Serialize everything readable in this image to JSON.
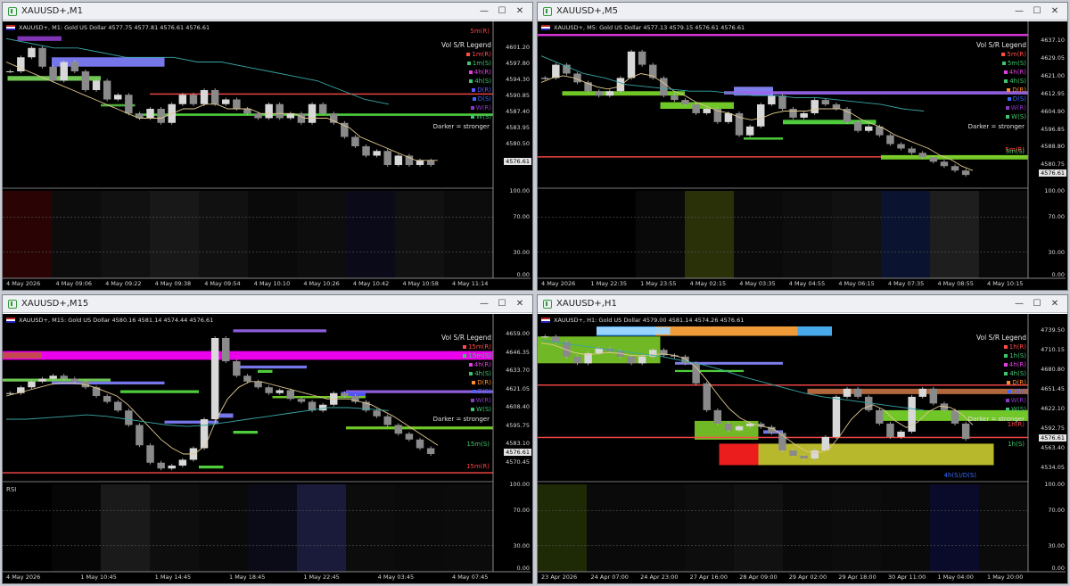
{
  "panels": [
    {
      "window_title": "XAUUSD+,M1",
      "symbol_info": "XAUUSD+, M1:  Gold US Dollar  4577.75 4577.81 4576.61 4576.61",
      "legend_title": "Vol S/R Legend",
      "legend_items": [
        {
          "text": "1m(R)",
          "color": "#ff4a4a"
        },
        {
          "text": "1m(S)",
          "color": "#3ec46d"
        },
        {
          "text": "4h(R)",
          "color": "#e040e0"
        },
        {
          "text": "4h(S)",
          "color": "#3ec46d"
        },
        {
          "text": "D(R)",
          "color": "#5a5aff"
        },
        {
          "text": "D(S)",
          "color": "#3a6aff"
        },
        {
          "text": "W(R)",
          "color": "#8a3ac4"
        },
        {
          "text": "W(S)",
          "color": "#3ec46d"
        }
      ],
      "zone_labels": [
        {
          "text": "5m(R)",
          "color": "#ff4040"
        },
        {
          "text": "Darker = stronger",
          "color": "#e0e0e0"
        }
      ],
      "price_axis": [
        "4601.20",
        "4597.80",
        "4594.30",
        "4590.85",
        "4587.40",
        "4583.95",
        "4580.50",
        "4576.61",
        "100.00",
        "70.00",
        "30.00",
        "0.00"
      ],
      "current_price": "4576.61",
      "time_axis": [
        "4 May 2026",
        "4 May 09:06",
        "4 May 09:22",
        "4 May 09:38",
        "4 May 09:54",
        "4 May 10:10",
        "4 May 10:26",
        "4 May 10:42",
        "4 May 10:58",
        "4 May 11:14"
      ],
      "price_range": [
        4572,
        4604
      ],
      "price_path": [
        4596,
        4599,
        4601,
        4597,
        4594,
        4598,
        4596,
        4592,
        4594,
        4590,
        4591,
        4587,
        4586,
        4588,
        4585,
        4589,
        4591,
        4589,
        4592,
        4589,
        4590,
        4588,
        4587,
        4586,
        4589,
        4586,
        4587,
        4585,
        4589,
        4587,
        4585,
        4582,
        4580,
        4578,
        4579,
        4576,
        4578,
        4576,
        4577,
        4576
      ],
      "sma_path": [
        4598,
        4597,
        4596,
        4595,
        4594,
        4593,
        4592,
        4591,
        4590,
        4589,
        4588,
        4587,
        4586,
        4586,
        4586,
        4587,
        4588,
        4588,
        4589,
        4589,
        4588,
        4588,
        4588,
        4587,
        4587,
        4587,
        4587,
        4586,
        4586,
        4586,
        4585,
        4584,
        4582,
        4581,
        4580,
        4579,
        4578,
        4577,
        4577,
        4577
      ],
      "teal_path": [
        4603,
        4602,
        4601,
        4601,
        4600,
        4599,
        4599,
        4599,
        4598,
        4598,
        4597,
        4596,
        4595,
        4594,
        4592,
        4590,
        4589
      ],
      "zones": [
        {
          "c": "#8080ff",
          "p1": 4599,
          "p2": 4597,
          "t1": 0.1,
          "t2": 0.33
        },
        {
          "c": "#7ad85a",
          "p1": 4595,
          "p2": 4594,
          "t1": 0.01,
          "t2": 0.2
        },
        {
          "c": "#55bb40",
          "p1": 4589,
          "p2": 4588.5,
          "t1": 0.2,
          "t2": 0.27
        },
        {
          "c": "#ff4a4a",
          "p1": 4591.3,
          "p2": 4591.1,
          "t1": 0.3,
          "t2": 1.0
        },
        {
          "c": "#55dd40",
          "p1": 4587.0,
          "p2": 4586.5,
          "t1": 0.27,
          "t2": 1.0
        },
        {
          "c": "#8a3ac4",
          "p1": 4603.5,
          "p2": 4602.5,
          "t1": 0.03,
          "t2": 0.12
        }
      ],
      "rsi_label": "",
      "rsi_cells": [
        "#2a0404",
        "#0c0c0c",
        "#111",
        "#181818",
        "#111",
        "#0a0a0a",
        "#0d0d0d",
        "#0a0a18",
        "#111",
        "#0c0c0c"
      ]
    },
    {
      "window_title": "XAUUSD+,M5",
      "symbol_info": "XAUUSD+, M5:  Gold US Dollar  4577.13 4579.15 4576.61 4576.61",
      "legend_title": "Vol S/R Legend",
      "legend_items": [
        {
          "text": "5m(R)",
          "color": "#ff4a4a"
        },
        {
          "text": "5m(S)",
          "color": "#3ec46d"
        },
        {
          "text": "4h(R)",
          "color": "#e040e0"
        },
        {
          "text": "4h(S)",
          "color": "#3ec46d"
        },
        {
          "text": "D(R)",
          "color": "#ff8a2a"
        },
        {
          "text": "D(S)",
          "color": "#3a6aff"
        },
        {
          "text": "W(R)",
          "color": "#8a3ac4"
        },
        {
          "text": "W(S)",
          "color": "#3ec46d"
        }
      ],
      "zone_labels": [
        {
          "text": "5m(R)",
          "color": "#ff4040"
        },
        {
          "text": "Darker = stronger",
          "color": "#e0e0e0"
        },
        {
          "text": "5m(S)",
          "color": "#3ec46d"
        }
      ],
      "price_axis": [
        "4637.10",
        "4629.05",
        "4621.00",
        "4612.95",
        "4604.90",
        "4596.85",
        "4588.80",
        "4580.75",
        "4576.61",
        "100.00",
        "70.00",
        "30.00",
        "0.00"
      ],
      "current_price": "4576.61",
      "time_axis": [
        "4 May 2026",
        "1 May 22:35",
        "1 May 23:55",
        "4 May 02:15",
        "4 May 03:35",
        "4 May 04:55",
        "4 May 06:15",
        "4 May 07:35",
        "4 May 08:55",
        "4 May 10:15"
      ],
      "price_range": [
        4572,
        4640
      ],
      "price_path": [
        4620,
        4626,
        4622,
        4618,
        4614,
        4612,
        4614,
        4620,
        4632,
        4626,
        4620,
        4612,
        4610,
        4608,
        4604,
        4606,
        4600,
        4604,
        4594,
        4598,
        4608,
        4612,
        4606,
        4602,
        4604,
        4610,
        4608,
        4606,
        4600,
        4596,
        4598,
        4594,
        4590,
        4588,
        4586,
        4584,
        4582,
        4580,
        4578,
        4576
      ],
      "sma_path": [
        4618,
        4620,
        4621,
        4620,
        4618,
        4616,
        4615,
        4616,
        4620,
        4622,
        4621,
        4618,
        4614,
        4612,
        4609,
        4607,
        4605,
        4604,
        4602,
        4601,
        4602,
        4604,
        4605,
        4605,
        4605,
        4606,
        4606,
        4606,
        4604,
        4601,
        4599,
        4597,
        4594,
        4592,
        4590,
        4588,
        4585,
        4583,
        4580,
        4578
      ],
      "teal_path": [
        4630,
        4626,
        4622,
        4620,
        4617,
        4616,
        4615,
        4614,
        4614,
        4613,
        4612,
        4612,
        4611,
        4611,
        4610,
        4609,
        4608,
        4606,
        4605
      ],
      "zones": [
        {
          "c": "#e83ae8",
          "p1": 4640,
          "p2": 4639,
          "t1": 0.0,
          "t2": 1.0
        },
        {
          "c": "#7ad82a",
          "p1": 4614,
          "p2": 4612,
          "t1": 0.05,
          "t2": 0.3
        },
        {
          "c": "#8a8aff",
          "p1": 4616,
          "p2": 4612,
          "t1": 0.4,
          "t2": 0.48
        },
        {
          "c": "#9966ee",
          "p1": 4614,
          "p2": 4612.5,
          "t1": 0.38,
          "t2": 1.0
        },
        {
          "c": "#7ad82a",
          "p1": 4609,
          "p2": 4606,
          "t1": 0.25,
          "t2": 0.4
        },
        {
          "c": "#55dd40",
          "p1": 4601,
          "p2": 4599,
          "t1": 0.5,
          "t2": 0.69
        },
        {
          "c": "#55dd40",
          "p1": 4593,
          "p2": 4592,
          "t1": 0.42,
          "t2": 0.5
        },
        {
          "c": "#ff4a4a",
          "p1": 4584.5,
          "p2": 4584.2,
          "t1": 0.0,
          "t2": 1.0
        },
        {
          "c": "#7ad82a",
          "p1": 4585,
          "p2": 4583,
          "t1": 0.7,
          "t2": 1.0
        }
      ],
      "rsi_label": "",
      "rsi_cells": [
        "#000",
        "#000",
        "#090909",
        "#2a3008",
        "#0a0a0a",
        "#0d0d0d",
        "#111",
        "#0a1430",
        "#1e1e1e",
        "#0a0a0a"
      ]
    },
    {
      "window_title": "XAUUSD+,M15",
      "symbol_info": "XAUUSD+, M15:  Gold US Dollar  4580.16 4581.14 4574.44 4576.61",
      "legend_title": "Vol S/R Legend",
      "legend_items": [
        {
          "text": "15m(R)",
          "color": "#ff4a4a"
        },
        {
          "text": "15m(S)",
          "color": "#3ec46d"
        },
        {
          "text": "4h(R)",
          "color": "#e040e0"
        },
        {
          "text": "4h(S)",
          "color": "#3ec46d"
        },
        {
          "text": "D(R)",
          "color": "#ff8a2a"
        },
        {
          "text": "D(S)",
          "color": "#3a6aff"
        },
        {
          "text": "W(R)",
          "color": "#8a3ac4"
        },
        {
          "text": "W(S)",
          "color": "#3ec46d"
        }
      ],
      "zone_labels": [
        {
          "text": "15m(R)",
          "color": "#ff4040"
        },
        {
          "text": "Darker = stronger",
          "color": "#e0e0e0"
        },
        {
          "text": "15m(S)",
          "color": "#3ec46d"
        }
      ],
      "price_axis": [
        "4659.00",
        "4646.35",
        "4633.70",
        "4621.05",
        "4608.40",
        "4595.75",
        "4583.10",
        "4576.61",
        "4570.45",
        "100.00",
        "70.00",
        "30.00",
        "0.00"
      ],
      "current_price": "4576.61",
      "time_axis": [
        "4 May 2026",
        "1 May 10:45",
        "1 May 14:45",
        "1 May 18:45",
        "1 May 22:45",
        "4 May 03:45",
        "4 May 07:45"
      ],
      "price_range": [
        4560,
        4664
      ],
      "price_path": [
        4618,
        4622,
        4626,
        4628,
        4630,
        4628,
        4626,
        4622,
        4616,
        4612,
        4606,
        4596,
        4582,
        4570,
        4566,
        4568,
        4572,
        4580,
        4600,
        4656,
        4640,
        4630,
        4626,
        4622,
        4618,
        4620,
        4614,
        4612,
        4606,
        4610,
        4618,
        4616,
        4612,
        4606,
        4602,
        4596,
        4590,
        4586,
        4580,
        4576
      ],
      "sma_path": [
        4616,
        4618,
        4620,
        4622,
        4624,
        4625,
        4625,
        4624,
        4622,
        4619,
        4616,
        4610,
        4602,
        4594,
        4586,
        4580,
        4576,
        4576,
        4582,
        4600,
        4614,
        4622,
        4626,
        4626,
        4624,
        4622,
        4620,
        4618,
        4616,
        4614,
        4614,
        4614,
        4612,
        4610,
        4606,
        4602,
        4597,
        4592,
        4587,
        4582
      ],
      "teal_path": [
        4600,
        4600,
        4601,
        4602,
        4603,
        4602,
        4600,
        4598,
        4596,
        4595,
        4596,
        4598,
        4600,
        4602,
        4604,
        4606,
        4608,
        4608,
        4607,
        4606
      ],
      "zones": [
        {
          "c": "#ff00ff",
          "p1": 4647,
          "p2": 4641,
          "t1": 0.0,
          "t2": 1.0
        },
        {
          "c": "#c05040",
          "p1": 4646,
          "p2": 4642,
          "t1": 0.0,
          "t2": 0.08
        },
        {
          "c": "#7ad85a",
          "p1": 4628,
          "p2": 4626,
          "t1": 0.0,
          "t2": 0.22
        },
        {
          "c": "#8080ff",
          "p1": 4626,
          "p2": 4624,
          "t1": 0.1,
          "t2": 0.33
        },
        {
          "c": "#55dd40",
          "p1": 4620,
          "p2": 4618,
          "t1": 0.24,
          "t2": 0.4
        },
        {
          "c": "#9966ee",
          "p1": 4620,
          "p2": 4618,
          "t1": 0.7,
          "t2": 1.0
        },
        {
          "c": "#5a5aff",
          "p1": 4619,
          "p2": 4616,
          "t1": 0.69,
          "t2": 0.74
        },
        {
          "c": "#7ad82a",
          "p1": 4616,
          "p2": 4614.5,
          "t1": 0.55,
          "t2": 0.74
        },
        {
          "c": "#9966ee",
          "p1": 4662,
          "p2": 4660,
          "t1": 0.47,
          "t2": 0.66
        },
        {
          "c": "#8080ff",
          "p1": 4637,
          "p2": 4635,
          "t1": 0.48,
          "t2": 0.62
        },
        {
          "c": "#55dd40",
          "p1": 4634,
          "p2": 4632,
          "t1": 0.52,
          "t2": 0.55
        },
        {
          "c": "#8080ff",
          "p1": 4604,
          "p2": 4601,
          "t1": 0.43,
          "t2": 0.47
        },
        {
          "c": "#8080ff",
          "p1": 4599,
          "p2": 4597,
          "t1": 0.33,
          "t2": 0.44
        },
        {
          "c": "#55dd40",
          "p1": 4592,
          "p2": 4590,
          "t1": 0.47,
          "t2": 0.52
        },
        {
          "c": "#55dd40",
          "p1": 4568,
          "p2": 4566,
          "t1": 0.4,
          "t2": 0.45
        },
        {
          "c": "#7ad82a",
          "p1": 4595,
          "p2": 4593,
          "t1": 0.7,
          "t2": 1.0
        },
        {
          "c": "#ff4a4a",
          "p1": 4563.5,
          "p2": 4563.2,
          "t1": 0.0,
          "t2": 1.0
        }
      ],
      "rsi_label": "RSI",
      "rsi_cells": [
        "#000",
        "#060606",
        "#1a1a1a",
        "#0e0e0e",
        "#0a0a0a",
        "#0b0b18",
        "#1a1a3a",
        "#0c0c0c",
        "#0a0a0a",
        "#0b0b0b"
      ]
    },
    {
      "window_title": "XAUUSD+,H1",
      "symbol_info": "XAUUSD+, H1:  Gold US Dollar  4579.00 4581.14 4574.26 4576.61",
      "legend_title": "Vol S/R Legend",
      "legend_items": [
        {
          "text": "1h(R)",
          "color": "#ff4a4a"
        },
        {
          "text": "1h(S)",
          "color": "#3ec46d"
        },
        {
          "text": "4h(R)",
          "color": "#e040e0"
        },
        {
          "text": "4h(S)",
          "color": "#3ec46d"
        },
        {
          "text": "D(R)",
          "color": "#ff8a2a"
        },
        {
          "text": "D(S)",
          "color": "#3a6aff"
        },
        {
          "text": "W(R)",
          "color": "#8a3ac4"
        },
        {
          "text": "W(S)",
          "color": "#3ec46d"
        }
      ],
      "zone_labels": [
        {
          "text": "1h(R)",
          "color": "#ff4040"
        },
        {
          "text": "Darker = stronger",
          "color": "#e0e0e0"
        },
        {
          "text": "1h(S)",
          "color": "#3ec46d"
        },
        {
          "text": "4h(S)/D(S)",
          "color": "#3a6aff"
        }
      ],
      "price_axis": [
        "4739.50",
        "4710.15",
        "4680.80",
        "4651.45",
        "4622.10",
        "4592.75",
        "4576.61",
        "4563.40",
        "4534.05",
        "100.00",
        "70.00",
        "30.00",
        "0.00"
      ],
      "current_price": "4576.61",
      "time_axis": [
        "23 Apr 2026",
        "24 Apr 07:00",
        "24 Apr 23:00",
        "27 Apr 16:00",
        "28 Apr 09:00",
        "29 Apr 02:00",
        "29 Apr 18:00",
        "30 Apr 11:00",
        "1 May 04:00",
        "1 May 20:00"
      ],
      "price_range": [
        4520,
        4745
      ],
      "price_path": [
        4730,
        4722,
        4700,
        4690,
        4705,
        4712,
        4708,
        4700,
        4690,
        4700,
        4710,
        4702,
        4700,
        4690,
        4660,
        4620,
        4600,
        4590,
        4596,
        4600,
        4595,
        4586,
        4560,
        4552,
        4548,
        4560,
        4580,
        4640,
        4652,
        4640,
        4620,
        4600,
        4580,
        4588,
        4640,
        4652,
        4630,
        4620,
        4600,
        4577
      ],
      "sma_path": [
        4720,
        4718,
        4712,
        4706,
        4703,
        4704,
        4706,
        4705,
        4702,
        4701,
        4703,
        4704,
        4702,
        4697,
        4684,
        4664,
        4642,
        4622,
        4608,
        4600,
        4596,
        4592,
        4580,
        4568,
        4558,
        4556,
        4562,
        4582,
        4606,
        4622,
        4628,
        4620,
        4604,
        4594,
        4602,
        4618,
        4626,
        4624,
        4614,
        4598
      ],
      "teal_path": [
        4725,
        4720,
        4716,
        4712,
        4708,
        4704,
        4700,
        4694,
        4688,
        4680,
        4670,
        4662,
        4654,
        4646,
        4640,
        4636,
        4632,
        4628,
        4624,
        4620
      ],
      "zones": [
        {
          "c": "#7ac828",
          "p1": 4730,
          "p2": 4690,
          "t1": 0.0,
          "t2": 0.25
        },
        {
          "c": "#4fb8ff",
          "p1": 4745,
          "p2": 4731,
          "t1": 0.12,
          "t2": 0.6
        },
        {
          "c": "#ff9a2a",
          "p1": 4745,
          "p2": 4731,
          "t1": 0.24,
          "t2": 0.53
        },
        {
          "c": "#a0d8ff",
          "p1": 4744,
          "p2": 4733,
          "t1": 0.12,
          "t2": 0.27
        },
        {
          "c": "#8a8aff",
          "p1": 4692,
          "p2": 4688,
          "t1": 0.28,
          "t2": 0.5
        },
        {
          "c": "#55dd40",
          "p1": 4680,
          "p2": 4677,
          "t1": 0.28,
          "t2": 0.42
        },
        {
          "c": "#c07040",
          "p1": 4652,
          "p2": 4644,
          "t1": 0.55,
          "t2": 1.0
        },
        {
          "c": "#7ad82a",
          "p1": 4620,
          "p2": 4604,
          "t1": 0.7,
          "t2": 1.0
        },
        {
          "c": "#7ac828",
          "p1": 4604,
          "p2": 4576,
          "t1": 0.32,
          "t2": 0.45
        },
        {
          "c": "#c8c830",
          "p1": 4570,
          "p2": 4538,
          "t1": 0.45,
          "t2": 0.93
        },
        {
          "c": "#ff2020",
          "p1": 4570,
          "p2": 4538,
          "t1": 0.37,
          "t2": 0.45
        },
        {
          "c": "#ff4a4a",
          "p1": 4658.5,
          "p2": 4658,
          "t1": 0.0,
          "t2": 1.0
        },
        {
          "c": "#ff4a4a",
          "p1": 4580.3,
          "p2": 4580,
          "t1": 0.0,
          "t2": 1.0
        },
        {
          "c": "#8080ff",
          "p1": 4590,
          "p2": 4585,
          "t1": 0.46,
          "t2": 0.5
        }
      ],
      "rsi_label": "",
      "rsi_cells": [
        "#1e2a06",
        "#0a0a0a",
        "#0a0a0a",
        "#0d0d0d",
        "#111",
        "#0a0a0a",
        "#0c0c0c",
        "#0a0a0a",
        "#0a0a2a",
        "#0b0b0b"
      ]
    }
  ],
  "window_buttons": {
    "minimize": "—",
    "maximize": "☐",
    "close": "✕"
  }
}
